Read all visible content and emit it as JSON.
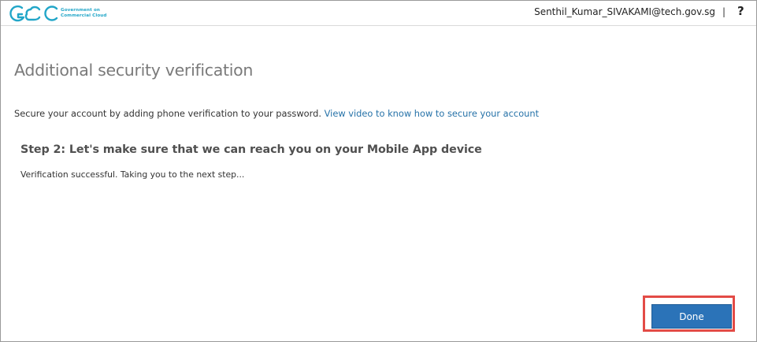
{
  "header": {
    "logo_line1": "Government on",
    "logo_line2": "Commercial Cloud",
    "user_email": "Senthil_Kumar_SIVAKAMI@tech.gov.sg",
    "separator": "|",
    "help_label": "?"
  },
  "main": {
    "title": "Additional security verification",
    "intro_text": "Secure your account by adding phone verification to your password.",
    "intro_link": "View video to know how to secure your account",
    "step_heading": "Step 2: Let's make sure that we can reach you on your Mobile App device",
    "status_text": "Verification successful. Taking you to the next step..."
  },
  "footer": {
    "done_label": "Done"
  },
  "colors": {
    "logo_blue": "#22a6c8",
    "link": "#2672a8",
    "button": "#2b73b8",
    "highlight": "#e34b46"
  }
}
